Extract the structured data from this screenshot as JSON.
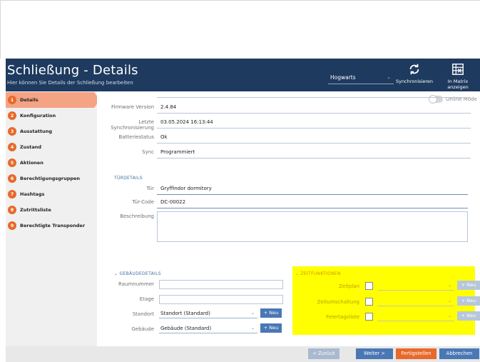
{
  "header": {
    "title": "Schließung - Details",
    "subtitle": "Hier können Sie Details der Schließung bearbeiten",
    "site": "Hogwarts",
    "sync_label": "Synchronisieren",
    "matrix_label": "In Matrix anzeigen",
    "bg_color": "#1e3a5f"
  },
  "sidebar": {
    "items": [
      {
        "num": "1",
        "label": "Details",
        "active": true
      },
      {
        "num": "2",
        "label": "Konfiguration"
      },
      {
        "num": "3",
        "label": "Ausstattung"
      },
      {
        "num": "4",
        "label": "Zustand"
      },
      {
        "num": "5",
        "label": "Aktionen"
      },
      {
        "num": "6",
        "label": "Berechtigungsgruppen"
      },
      {
        "num": "7",
        "label": "Hashtags"
      },
      {
        "num": "8",
        "label": "Zutrittsliste"
      },
      {
        "num": "9",
        "label": "Berechtigte Transponder"
      }
    ],
    "accent": "#e8692a"
  },
  "online_mode_label": "Online Mode",
  "status": {
    "firmware_label": "Firmware Version",
    "firmware_value": "2.4.84",
    "sync_date_label": "Letzte Synchronisierung",
    "sync_date_value": "03.05.2024 16:13:44",
    "battery_label": "Batteriestatus",
    "battery_value": "Ok",
    "sync_label": "Sync",
    "sync_value": "Programmiert"
  },
  "door": {
    "section": "TÜRDETAILS",
    "door_label": "Tür",
    "door_value": "Gryffindor dormitory",
    "code_label": "Tür-Code",
    "code_value": "DC-00022",
    "desc_label": "Beschreibung",
    "desc_value": ""
  },
  "building": {
    "section": "GEBÄUDEDETAILS",
    "room_label": "Raumnummer",
    "room_value": "",
    "floor_label": "Etage",
    "floor_value": "",
    "location_label": "Standort",
    "location_value": "Standort (Standard)",
    "building_label": "Gebäude",
    "building_value": "Gebäude (Standard)",
    "new_label": "+ Neu"
  },
  "time": {
    "section": "ZEITFUNKTIONEN",
    "schedule_label": "Zeitplan",
    "switch_label": "Zeitumschaltung",
    "holiday_label": "Feiertagsliste",
    "new_label": "+ Neu"
  },
  "footer": {
    "back": "< Zurück",
    "next": "Weiter >",
    "finish": "Fertigstellen",
    "cancel": "Abbrechen"
  }
}
